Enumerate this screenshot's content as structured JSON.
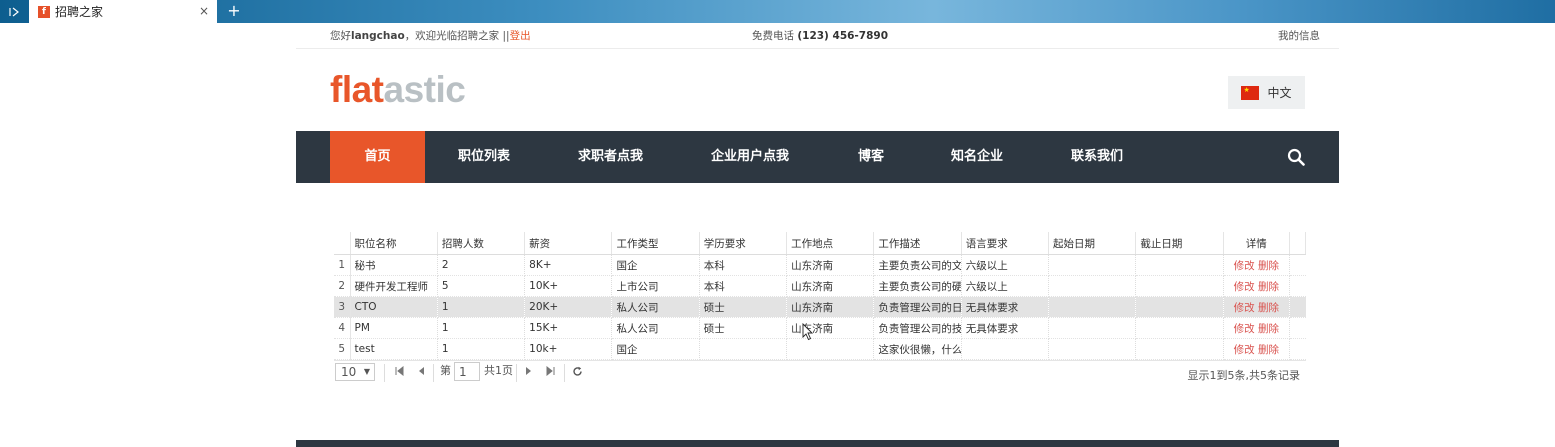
{
  "browser": {
    "tab_title": "招聘之家",
    "favicon_letter": "f",
    "close_glyph": "×",
    "newtab_glyph": "+"
  },
  "topbar": {
    "greeting_prefix": "您好",
    "username": "langchao",
    "greeting_suffix": "，欢迎光临招聘之家 ||",
    "logout": "登出",
    "phone_label": "免费电话",
    "phone": "(123) 456-7890",
    "my_info": "我的信息"
  },
  "logo": {
    "part1": "flat",
    "part2": "astic"
  },
  "language": {
    "label": "中文"
  },
  "nav": {
    "items": [
      "首页",
      "职位列表",
      "求职者点我",
      "企业用户点我",
      "博客",
      "知名企业",
      "联系我们"
    ],
    "active_index": 0
  },
  "table": {
    "columns": [
      "职位名称",
      "招聘人数",
      "薪资",
      "工作类型",
      "学历要求",
      "工作地点",
      "工作描述",
      "语言要求",
      "起始日期",
      "截止日期",
      "详情"
    ],
    "rows": [
      [
        "1",
        "秘书",
        "2",
        "8K+",
        "国企",
        "本科",
        "山东济南",
        "主要负责公司的文",
        "六级以上",
        "",
        ""
      ],
      [
        "2",
        "硬件开发工程师",
        "5",
        "10K+",
        "上市公司",
        "本科",
        "山东济南",
        "主要负责公司的硬",
        "六级以上",
        "",
        ""
      ],
      [
        "3",
        "CTO",
        "1",
        "20K+",
        "私人公司",
        "硕士",
        "山东济南",
        "负责管理公司的日",
        "无具体要求",
        "",
        ""
      ],
      [
        "4",
        "PM",
        "1",
        "15K+",
        "私人公司",
        "硕士",
        "山东济南",
        "负责管理公司的技",
        "无具体要求",
        "",
        ""
      ],
      [
        "5",
        "test",
        "1",
        "10k+",
        "国企",
        "",
        "",
        "这家伙很懒，什么",
        "",
        "",
        ""
      ]
    ],
    "edit_label": "修改",
    "delete_label": "删除",
    "selected_row": 2
  },
  "pager": {
    "page_size": "10",
    "page_label": "第",
    "page_current": "1",
    "page_total": "共1页",
    "info": "显示1到5条,共5条记录"
  },
  "colors": {
    "accent": "#e8562a",
    "nav_bg": "#2d3741"
  }
}
